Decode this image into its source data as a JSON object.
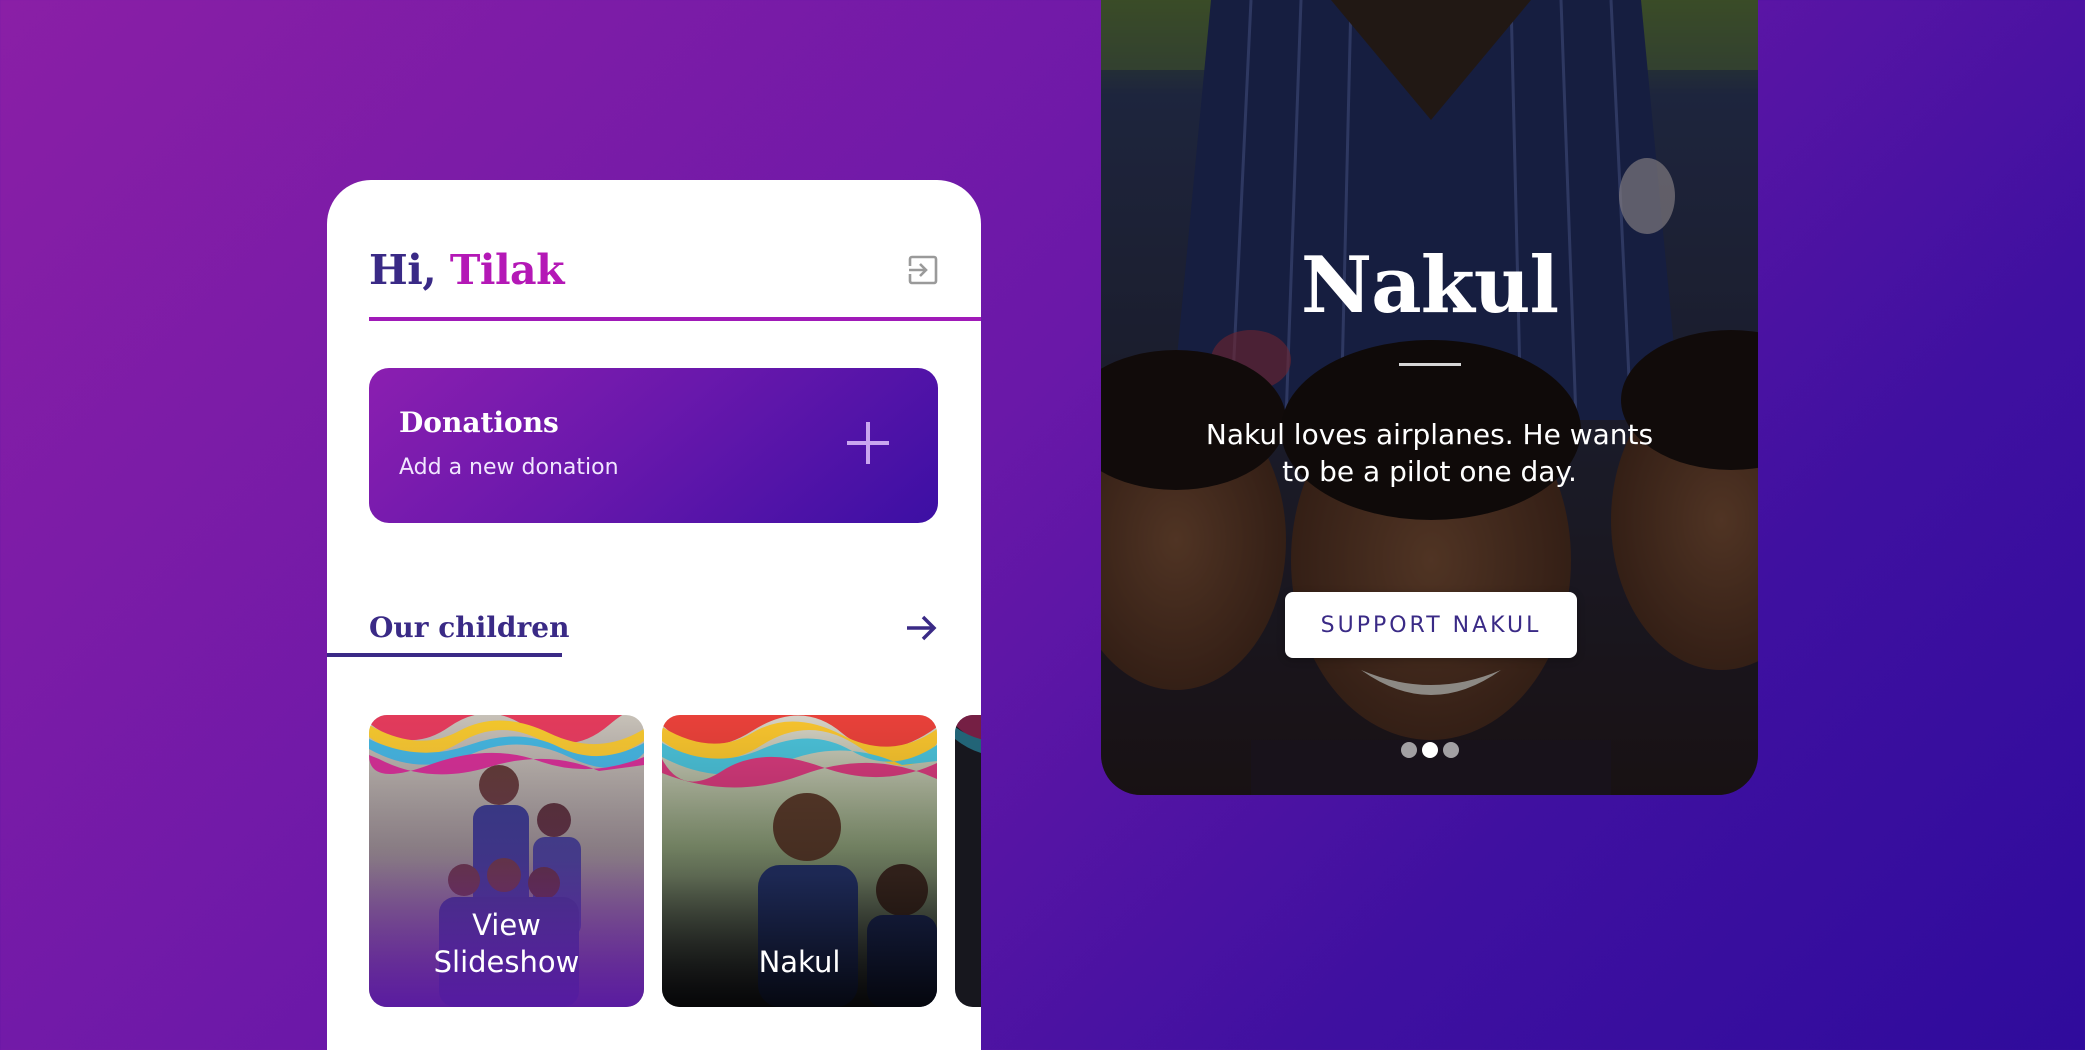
{
  "header": {
    "greeting_prefix": "Hi,",
    "user_name": "Tilak",
    "logout_icon": "logout-icon"
  },
  "donations": {
    "title": "Donations",
    "subtitle": "Add a new donation",
    "action_icon": "plus-icon"
  },
  "children_section": {
    "title": "Our children",
    "action_icon": "arrow-right-icon",
    "cards": [
      {
        "label": "View Slideshow"
      },
      {
        "label": "Nakul"
      },
      {
        "label": ""
      }
    ]
  },
  "hero": {
    "name": "Nakul",
    "description": "Nakul loves airplanes. He wants to be a pilot one day.",
    "button_label": "SUPPORT NAKUL",
    "slides_total": 3,
    "active_slide": 2
  },
  "colors": {
    "accent_purple": "#b418b6",
    "dark_indigo": "#3a2a86",
    "gradient_start": "#8a1fa6",
    "gradient_end": "#2f0b9c"
  }
}
